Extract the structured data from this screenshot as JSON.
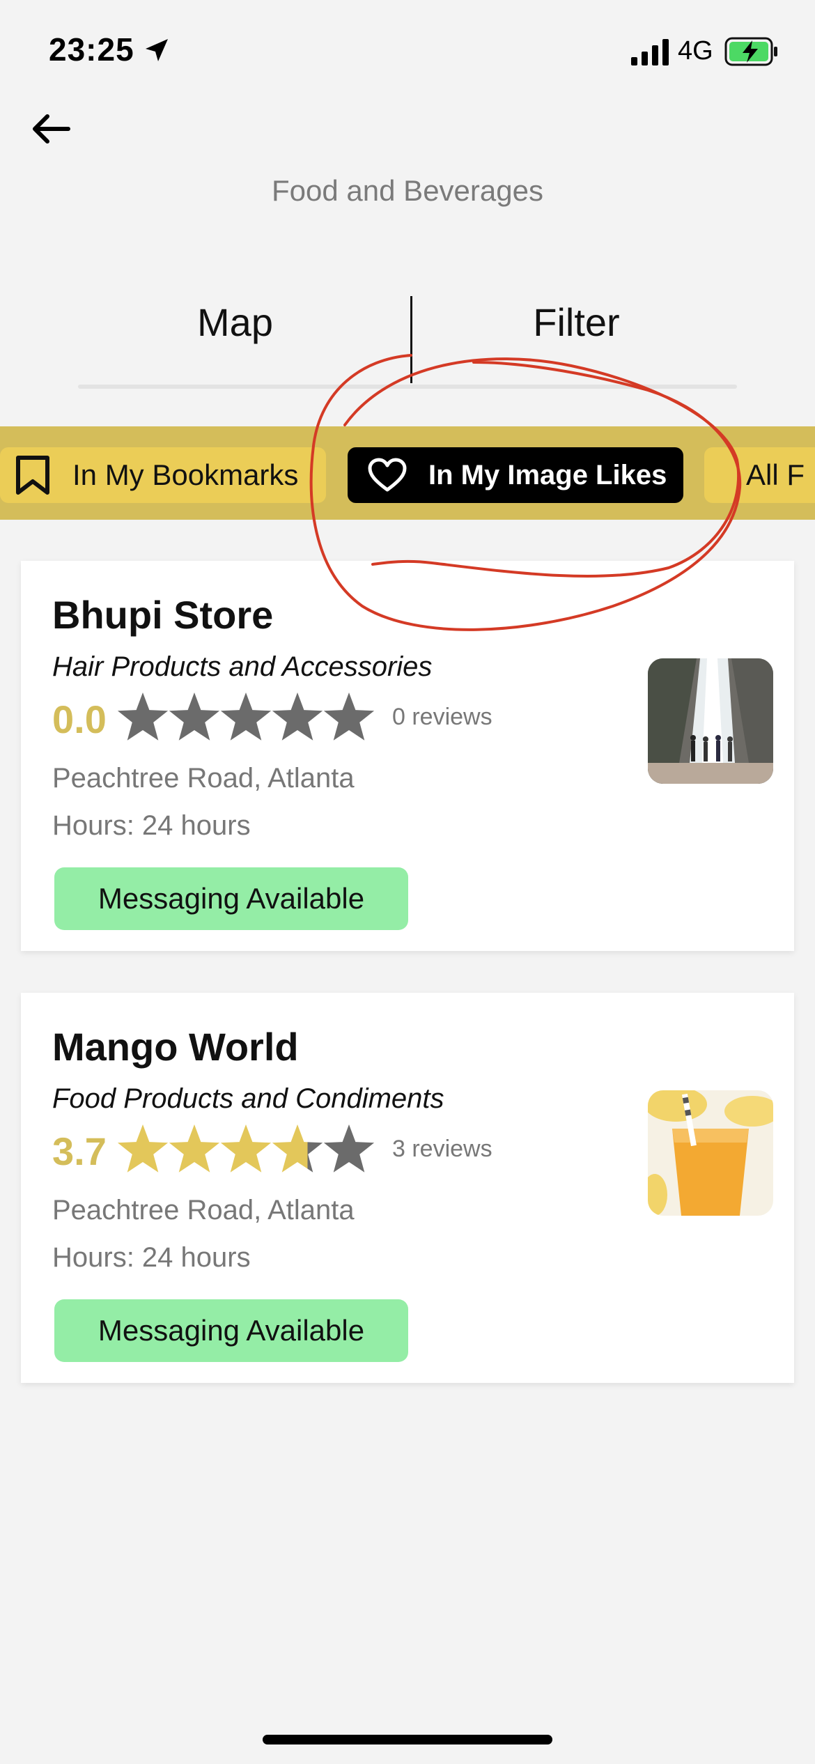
{
  "status_bar": {
    "time": "23:25",
    "network": "4G"
  },
  "header": {
    "title": "Food and Beverages"
  },
  "tabs": {
    "map_label": "Map",
    "filter_label": "Filter"
  },
  "chips": [
    {
      "label": "In My Bookmarks",
      "icon": "bookmark-icon",
      "selected": false
    },
    {
      "label": "In My Image Likes",
      "icon": "heart-icon",
      "selected": true
    },
    {
      "label": "All F",
      "selected": false
    }
  ],
  "colors": {
    "accent_yellow": "#ebcd57",
    "strip_yellow": "#d4bd5a",
    "star_gold": "#e3c75a",
    "star_grey": "#6b6b6b",
    "messaging_green": "#94eda6",
    "annotation_red": "#d43a25"
  },
  "stores": [
    {
      "name": "Bhupi Store",
      "category": "Hair Products and Accessories",
      "rating": "0.0",
      "rating_value": 0.0,
      "reviews": "0 reviews",
      "address": "Peachtree Road, Atlanta",
      "hours": "Hours:  24 hours",
      "messaging": "Messaging Available",
      "thumbnail": "waterfall-photo"
    },
    {
      "name": "Mango World",
      "category": "Food Products and Condiments",
      "rating": "3.7",
      "rating_value": 3.7,
      "reviews": "3 reviews",
      "address": "Peachtree Road, Atlanta",
      "hours": "Hours:  24 hours",
      "messaging": "Messaging Available",
      "thumbnail": "mango-smoothie-photo"
    }
  ]
}
